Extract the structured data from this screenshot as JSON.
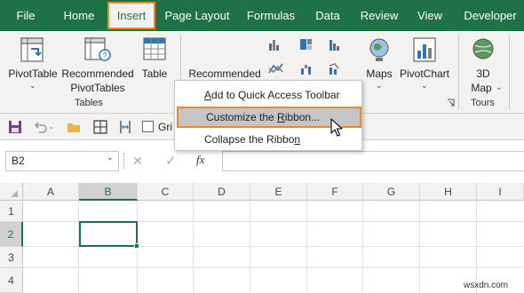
{
  "tabs": [
    "File",
    "Home",
    "Insert",
    "Page Layout",
    "Formulas",
    "Data",
    "Review",
    "View",
    "Developer"
  ],
  "active_tab": "Insert",
  "ribbon": {
    "pivottable": "PivotTable",
    "recommended_pivottables_1": "Recommended",
    "recommended_pivottables_2": "PivotTables",
    "table": "Table",
    "tables_group": "Tables",
    "recommended_charts": "Recommended",
    "maps": "Maps",
    "pivotchart": "PivotChart",
    "map3d_1": "3D",
    "map3d_2": "Map",
    "tours_group": "Tours"
  },
  "qat": {
    "gridlines_label": "Gri"
  },
  "formula_bar": {
    "name_box": "B2",
    "fx": "fx",
    "cancel": "✕",
    "enter": "✓"
  },
  "grid": {
    "columns": [
      "A",
      "B",
      "C",
      "D",
      "E",
      "F",
      "G",
      "H",
      "I"
    ],
    "rows": [
      "1",
      "2",
      "3",
      "4"
    ],
    "selected_cell": "B2"
  },
  "context_menu": {
    "items": [
      {
        "prefix": "",
        "mnemonic": "A",
        "suffix": "dd to Quick Access Toolbar"
      },
      {
        "prefix": "Customize the ",
        "mnemonic": "R",
        "suffix": "ibbon..."
      },
      {
        "prefix": "Collapse the Ribbo",
        "mnemonic": "n",
        "suffix": ""
      }
    ]
  },
  "watermark": "wsxdn.com",
  "colors": {
    "excel_green": "#1f7246",
    "highlight_orange": "#ee8a25",
    "ribbon_bg": "#f3f2f1"
  }
}
